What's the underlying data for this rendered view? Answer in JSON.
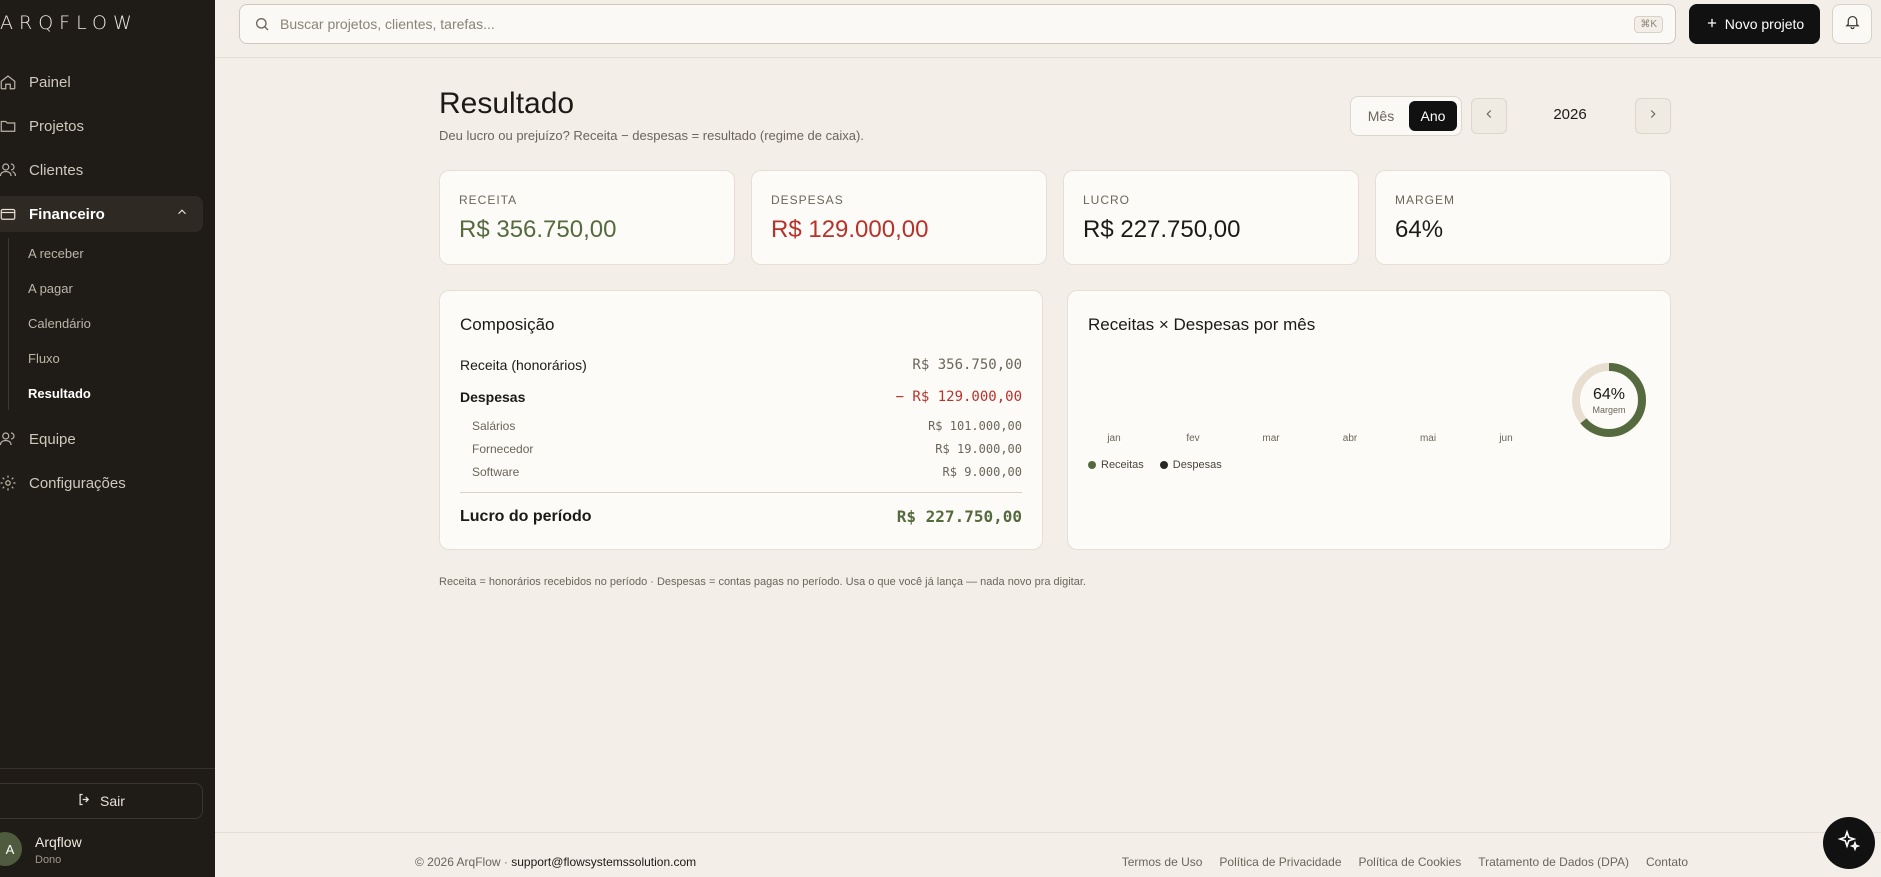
{
  "app": {
    "logo": "ARQFLOW"
  },
  "sidebar": {
    "items": [
      {
        "label": "Painel",
        "icon": "home-icon"
      },
      {
        "label": "Projetos",
        "icon": "folder-icon"
      },
      {
        "label": "Clientes",
        "icon": "users-icon"
      },
      {
        "label": "Financeiro",
        "icon": "wallet-icon"
      },
      {
        "label": "Equipe",
        "icon": "team-icon"
      },
      {
        "label": "Configurações",
        "icon": "gear-icon"
      }
    ],
    "financeiro_sub": [
      "A receber",
      "A pagar",
      "Calendário",
      "Fluxo",
      "Resultado"
    ],
    "logout": "Sair",
    "user": {
      "initial": "A",
      "name": "Arqflow",
      "role": "Dono"
    }
  },
  "topbar": {
    "search_placeholder": "Buscar projetos, clientes, tarefas...",
    "shortcut": "⌘K",
    "new_project": "Novo projeto"
  },
  "page": {
    "title": "Resultado",
    "subtitle": "Deu lucro ou prejuízo? Receita − despesas = resultado (regime de caixa).",
    "period_toggle": [
      "Mês",
      "Ano"
    ],
    "period_selected": "Ano",
    "year": "2026"
  },
  "kpis": [
    {
      "label": "RECEITA",
      "value": "R$ 356.750,00",
      "color": "#556b3f"
    },
    {
      "label": "DESPESAS",
      "value": "R$ 129.000,00",
      "color": "#b8322a"
    },
    {
      "label": "LUCRO",
      "value": "R$ 227.750,00",
      "color": "#1c1a16"
    },
    {
      "label": "MARGEM",
      "value": "64%",
      "color": "#1c1a16"
    }
  ],
  "composicao": {
    "title": "Composição",
    "receita": {
      "label": "Receita (honorários)",
      "value": "R$ 356.750,00"
    },
    "despesas": {
      "label": "Despesas",
      "value": "− R$ 129.000,00"
    },
    "itens": [
      {
        "label": "Salários",
        "value": "R$ 101.000,00"
      },
      {
        "label": "Fornecedor",
        "value": "R$ 19.000,00"
      },
      {
        "label": "Software",
        "value": "R$ 9.000,00"
      }
    ],
    "lucro": {
      "label": "Lucro do período",
      "value": "R$ 227.750,00"
    }
  },
  "chart": {
    "title": "Receitas × Despesas por mês",
    "months": [
      "jan",
      "fev",
      "mar",
      "abr",
      "mai",
      "jun"
    ],
    "legend": [
      "Receitas",
      "Despesas"
    ],
    "margin_pct": "64%",
    "margin_label": "Margem",
    "margin_value": 64,
    "colors": {
      "receitas": "#556b3f",
      "despesas": "#2a2823",
      "ring_bg": "#e8dfd0"
    }
  },
  "footnote": "Receita = honorários recebidos no período · Despesas = contas pagas no período. Usa o que você já lança — nada novo pra digitar.",
  "footer": {
    "copyright": "© 2026 ArqFlow ·",
    "email": "support@flowsystemssolution.com",
    "links": [
      "Termos de Uso",
      "Política de Privacidade",
      "Política de Cookies",
      "Tratamento de Dados (DPA)",
      "Contato"
    ]
  }
}
